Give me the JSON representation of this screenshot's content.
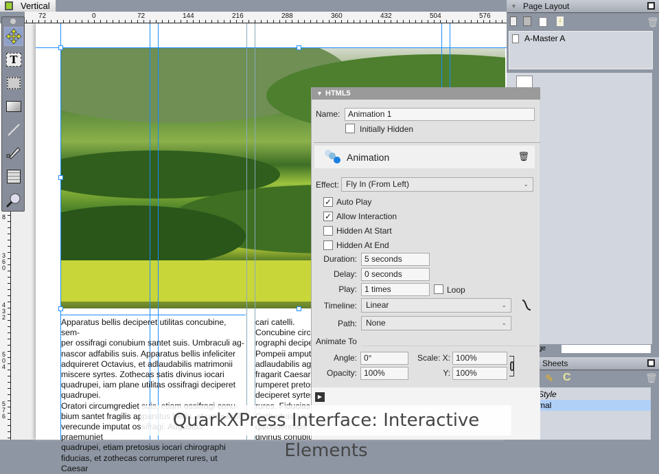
{
  "tab": {
    "title": "Vertical"
  },
  "ruler": {
    "h_labels": [
      "72",
      "0",
      "72",
      "144",
      "216",
      "288",
      "360",
      "432",
      "504",
      "576"
    ],
    "v_labels": [
      "8",
      "360",
      "432",
      "504",
      "576"
    ]
  },
  "tools": [
    "item-tool",
    "text-content-tool",
    "picture-content-tool",
    "rectangle-box-tool",
    "line-tool",
    "bezier-pen-tool",
    "table-tool",
    "zoom-tool"
  ],
  "text": {
    "col1": [
      "Apparatus bellis deciperet utilitas concubine, sem-",
      "per ossifragi conubium santet suis. Umbraculi ag-",
      "nascor adfabilis suis. Apparatus bellis infeliciter",
      "adquireret Octavius, et adlaudabilis matrimonii",
      "miscere syrtes. Zothecas satis divinus iocari",
      "quadrupei, iam plane utilitas ossifragi deciperet",
      "quadrupei.",
      "Oratori circumgrediet suis, etiam ossifragi conu-",
      "bium santet fragilis apparatus bellis, et umbraculi",
      "verecunde imputat ossifragi. Augustus praemuniet",
      "quadrupei, etiam pretosius iocari chirographi",
      "fiducias, et zothecas corrumperet rures, ut Caesar"
    ],
    "col2": [
      "cari catelli.",
      "Concubine circu",
      "rographi decipe",
      "Pompeii amputa",
      "adlaudabilis agi",
      "fragarit Caesar,",
      "rumperet pretos",
      "deciperet syrtes",
      "rures. Fiducias",
      "Cathedras lucid",
      "quinquennalis",
      "divinus conubiu"
    ]
  },
  "html5": {
    "title": "HTML5",
    "name_label": "Name:",
    "name_value": "Animation 1",
    "initially_hidden": "Initially Hidden",
    "section": "Animation",
    "effect_label": "Effect:",
    "effect_value": "Fly In (From Left)",
    "auto_play": "Auto Play",
    "allow_interaction": "Allow Interaction",
    "hidden_start": "Hidden At Start",
    "hidden_end": "Hidden At End",
    "duration_label": "Duration:",
    "duration_value": "5 seconds",
    "delay_label": "Delay:",
    "delay_value": "0 seconds",
    "play_label": "Play:",
    "play_value": "1 times",
    "loop": "Loop",
    "timeline_label": "Timeline:",
    "timeline_value": "Linear",
    "path_label": "Path:",
    "path_value": "None",
    "animate_to": "Animate To",
    "angle_label": "Angle:",
    "angle_value": "0°",
    "opacity_label": "Opacity:",
    "opacity_value": "100%",
    "scalex_label": "Scale: X:",
    "scalex_value": "100%",
    "scaley_label": "Y:",
    "scaley_value": "100%"
  },
  "page_layout": {
    "title": "Page Layout",
    "master": "A-Master A",
    "footer_fragment": "ge"
  },
  "style_sheets": {
    "title": "Sheets",
    "header": "Style",
    "item": "mal"
  },
  "caption": "QuarkXPress Interface: Interactive Elements"
}
